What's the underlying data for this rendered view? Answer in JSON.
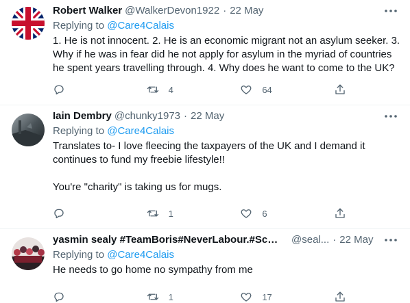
{
  "tweets": [
    {
      "name": "Robert Walker",
      "handle": "@WalkerDevon1922",
      "separator": "·",
      "date": "22 May",
      "replying_prefix": "Replying to ",
      "replying_to": "@Care4Calais",
      "body_lines": [
        "1. He is not innocent. 2. He is an economic migrant not an asylum seeker. 3. Why if he was in fear did he not apply for asylum in the myriad of countries he spent years travelling through. 4. Why does he want to come to the UK?"
      ],
      "stats": {
        "replies": "",
        "retweets": "4",
        "likes": "64"
      },
      "avatar": "union-jack"
    },
    {
      "name": "Iain Dembry",
      "handle": "@chunky1973",
      "separator": "·",
      "date": "22 May",
      "replying_prefix": "Replying to ",
      "replying_to": "@Care4Calais",
      "body_lines": [
        "Translates to- I love fleecing the taxpayers of the UK and I demand it continues to fund my freebie lifestyle!!",
        "You're \"charity\" is taking us for mugs."
      ],
      "stats": {
        "replies": "",
        "retweets": "1",
        "likes": "6"
      },
      "avatar": "photo-dark"
    },
    {
      "name": "yasmin sealy #TeamBoris#NeverLabour.#Scu...",
      "handle": "@seal...",
      "separator": "·",
      "date": "22 May",
      "replying_prefix": "Replying to ",
      "replying_to": "@Care4Calais",
      "body_lines": [
        "He needs to go home no sympathy from me"
      ],
      "stats": {
        "replies": "",
        "retweets": "1",
        "likes": "17"
      },
      "avatar": "group-photo"
    }
  ],
  "colors": {
    "link": "#1d9bf0",
    "muted": "#536471",
    "text": "#0f1419",
    "divider": "#eff3f4"
  }
}
